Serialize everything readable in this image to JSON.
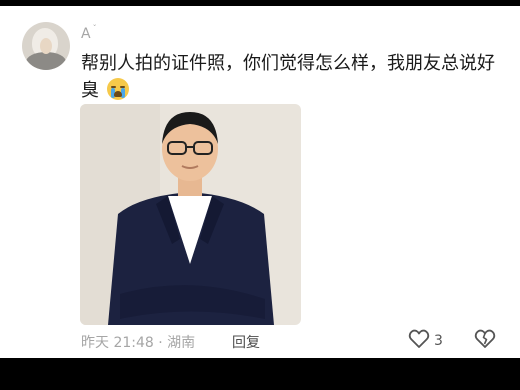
{
  "comment": {
    "username": "A",
    "text": "帮别人拍的证件照，你们觉得怎么样，我朋友总说好臭",
    "emoji": "loudly-crying-face",
    "time": "昨天 21:48",
    "separator": "·",
    "location": "湖南",
    "reply_label": "回复",
    "like_count": "3",
    "icons": {
      "like": "heart-outline-icon",
      "dislike": "broken-heart-icon"
    }
  },
  "colors": {
    "background": "#000000",
    "card": "#ffffff",
    "text_primary": "#1a1a1a",
    "text_secondary": "#a6a6a6"
  }
}
